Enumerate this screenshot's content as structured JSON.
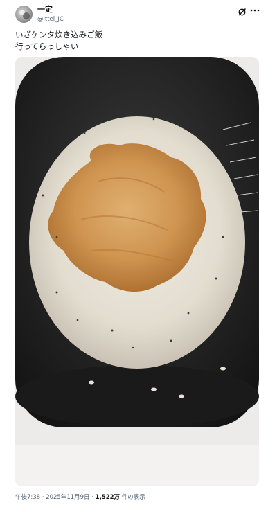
{
  "post": {
    "author_name": "一定",
    "author_handle": "@ittei_JC",
    "text_line1": "いざケンタ炊き込みご飯",
    "text_line2": "行ってらっしゃい",
    "time": "午後7:38",
    "separator": "·",
    "date": "2025年11月9日",
    "views_count": "1,522万",
    "views_label": "件の表示"
  },
  "icons": {
    "grok": "grok-icon",
    "more": "more-dots-icon"
  },
  "colors": {
    "text": "#0f1419",
    "secondary": "#536471"
  }
}
